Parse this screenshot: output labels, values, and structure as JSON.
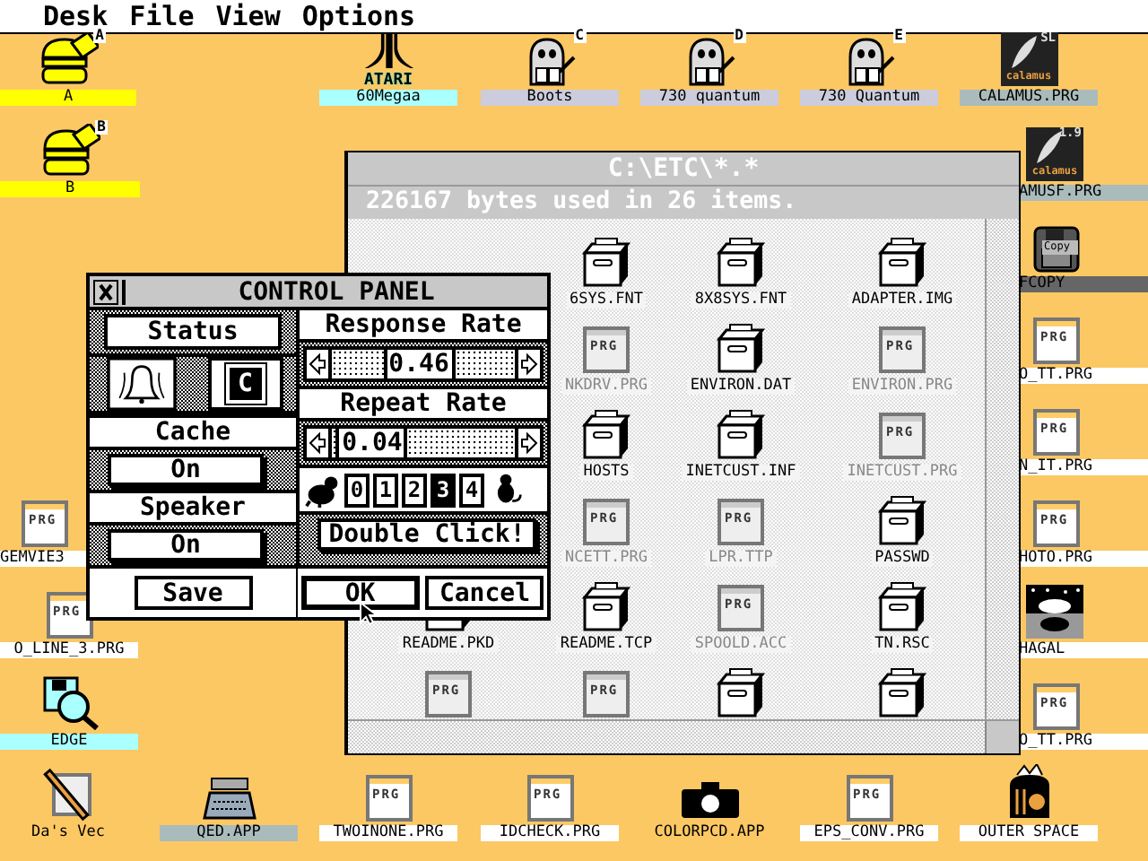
{
  "menu_bar": {
    "items": [
      "Desk",
      "File",
      "View",
      "Options"
    ]
  },
  "desktop_icons": [
    {
      "label": "A",
      "kind": "drive",
      "letter": "A",
      "color": "#ffff00"
    },
    {
      "label": "60Megaa",
      "kind": "atari",
      "logo_text": "ATARI",
      "color": "#aaffff"
    },
    {
      "label": "Boots",
      "kind": "fox",
      "letter": "C",
      "color": "#ccccdd"
    },
    {
      "label": "730 quantum",
      "kind": "fox",
      "letter": "D",
      "color": "#ccccdd"
    },
    {
      "label": "730 Quantum",
      "kind": "fox",
      "letter": "E",
      "color": "#ccccdd"
    },
    {
      "label": "CALAMUS.PRG",
      "kind": "calamus",
      "badge": "SL",
      "logo_text": "calamus",
      "color": "#aabbbb"
    },
    {
      "label": "B",
      "kind": "drive",
      "letter": "B",
      "color": "#ffff00"
    },
    {
      "label": "AMUSF.PRG",
      "kind": "calamus",
      "badge": "1.9",
      "logo_text": "calamus",
      "color": "#aabbbb"
    },
    {
      "label": "FCOPY",
      "kind": "floppy",
      "badge": "Copy",
      "color": "#666666"
    },
    {
      "label": "O_TT.PRG",
      "kind": "prg",
      "icon_text": "PRG",
      "color": "#ffffff"
    },
    {
      "label": "N_IT.PRG",
      "kind": "prg",
      "icon_text": "PRG",
      "color": "#ffffff"
    },
    {
      "label": "HOTO.PRG",
      "kind": "prg",
      "icon_text": "PRG",
      "color": "#ffffff"
    },
    {
      "label": "HAGAL",
      "kind": "picture",
      "color": "#ffffff"
    },
    {
      "label": "O_TT.PRG",
      "kind": "prg",
      "icon_text": "PRG",
      "color": "#ffffff"
    },
    {
      "label": "GEMVIE3",
      "kind": "prg",
      "icon_text": "PRG",
      "color": "#ffffff"
    },
    {
      "label": "O_LINE_3.PRG",
      "kind": "prg",
      "icon_text": "PRG",
      "color": "#ffffff"
    },
    {
      "label": "EDGE",
      "kind": "edge",
      "color": "#aaffff"
    },
    {
      "label": "Da's Vec",
      "kind": "pen"
    },
    {
      "label": "QED.APP",
      "kind": "typewriter",
      "color": "#aabbbb"
    },
    {
      "label": "TWOINONE.PRG",
      "kind": "prg",
      "icon_text": "PRG",
      "color": "#ffffff"
    },
    {
      "label": "IDCHECK.PRG",
      "kind": "prg",
      "icon_text": "PRG",
      "color": "#ffffff"
    },
    {
      "label": "COLORPCD.APP",
      "kind": "camera"
    },
    {
      "label": "EPS_CONV.PRG",
      "kind": "prg",
      "icon_text": "PRG",
      "color": "#ffffff"
    },
    {
      "label": "OUTER SPACE",
      "kind": "bag",
      "color": "#ffffff"
    }
  ],
  "file_window": {
    "title": "C:\\ETC\\*.*",
    "info": "226167 bytes used in 26 items.",
    "files": [
      {
        "label": "6SYS.FNT",
        "kind": "drawer"
      },
      {
        "label": "8X8SYS.FNT",
        "kind": "drawer"
      },
      {
        "label": "ADAPTER.IMG",
        "kind": "drawer"
      },
      {
        "label": "NKDRV.PRG",
        "kind": "prg",
        "icon_text": "PRG"
      },
      {
        "label": "ENVIRON.DAT",
        "kind": "drawer"
      },
      {
        "label": "ENVIRON.PRG",
        "kind": "prg",
        "icon_text": "PRG"
      },
      {
        "label": "HOSTS",
        "kind": "drawer"
      },
      {
        "label": "INETCUST.INF",
        "kind": "drawer"
      },
      {
        "label": "INETCUST.PRG",
        "kind": "prg",
        "icon_text": "PRG"
      },
      {
        "label": "NCETT.PRG",
        "kind": "prg",
        "icon_text": "PRG"
      },
      {
        "label": "LPR.TTP",
        "kind": "prg",
        "icon_text": "PRG"
      },
      {
        "label": "PASSWD",
        "kind": "drawer"
      },
      {
        "label": "README.PKD",
        "kind": "drawer"
      },
      {
        "label": "README.TCP",
        "kind": "drawer"
      },
      {
        "label": "SPOOLD.ACC",
        "kind": "prg",
        "icon_text": "PRG"
      },
      {
        "label": "TN.RSC",
        "kind": "drawer"
      },
      {
        "kind": "prg",
        "icon_text": "PRG"
      },
      {
        "kind": "prg",
        "icon_text": "PRG"
      },
      {
        "kind": "drawer"
      },
      {
        "kind": "drawer"
      }
    ]
  },
  "control_panel": {
    "title": "CONTROL PANEL",
    "status": {
      "label": "Status",
      "key_letter": "C"
    },
    "cache": {
      "label": "Cache",
      "value": "On"
    },
    "speaker": {
      "label": "Speaker",
      "value": "On"
    },
    "response_rate": {
      "label": "Response Rate",
      "value": "0.46",
      "level": 0.46
    },
    "repeat_rate": {
      "label": "Repeat Rate",
      "value": "0.04",
      "level": 0.04
    },
    "double_click": {
      "button": "Double Click!",
      "speeds": [
        {
          "label": "0",
          "selected": false
        },
        {
          "label": "1",
          "selected": false
        },
        {
          "label": "2",
          "selected": false
        },
        {
          "label": "3",
          "selected": true
        },
        {
          "label": "4",
          "selected": false
        }
      ]
    },
    "buttons": [
      {
        "label": "Save",
        "default": false
      },
      {
        "label": "OK",
        "default": true
      },
      {
        "label": "Cancel",
        "default": false
      }
    ]
  }
}
